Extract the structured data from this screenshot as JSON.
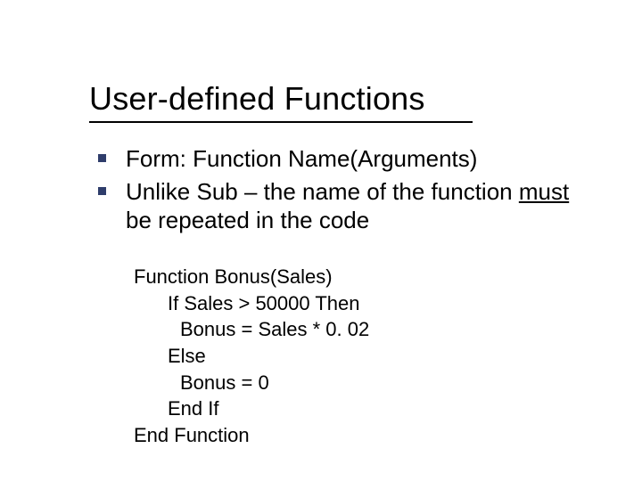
{
  "title": "User-defined Functions",
  "bullets": [
    {
      "text": "Form: Function Name(Arguments)"
    },
    {
      "prefix": "Unlike Sub – the name of the function ",
      "underlined": "must",
      "suffix": " be repeated in the code"
    }
  ],
  "code": {
    "l0": "Function Bonus(Sales)",
    "l1": "If Sales > 50000 Then",
    "l2": "Bonus = Sales * 0. 02",
    "l3": "Else",
    "l4": "Bonus = 0",
    "l5": "End If",
    "l6": "End Function"
  }
}
